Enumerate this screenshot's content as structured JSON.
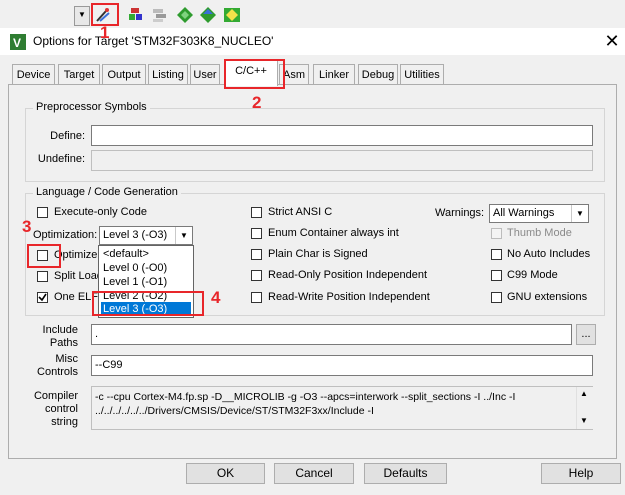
{
  "toolbar": {
    "icons": [
      "dropdown-arrow-icon",
      "magic-wand-options-icon",
      "stack-icon",
      "layers-icon",
      "diamond-green-icon",
      "diamond-move-icon",
      "diamond-multi-icon"
    ]
  },
  "dialog": {
    "title": "Options for Target 'STM32F303K8_NUCLEO'",
    "close": "✕"
  },
  "tabs": [
    "Device",
    "Target",
    "Output",
    "Listing",
    "User",
    "C/C++",
    "Asm",
    "Linker",
    "Debug",
    "Utilities"
  ],
  "active_tab": "C/C++",
  "preprocessor": {
    "group_title": "Preprocessor Symbols",
    "define_label": "Define:",
    "define_value": "",
    "undefine_label": "Undefine:",
    "undefine_value": ""
  },
  "language": {
    "group_title": "Language / Code Generation",
    "execute_only": "Execute-only Code",
    "optimization_label": "Optimization:",
    "optimization_value": "Level 3 (-O3)",
    "optimize_for_time": "Optimize f",
    "split_load": "Split Load",
    "one_elf": "One ELF",
    "strict_ansi": "Strict ANSI C",
    "enum_container": "Enum Container always int",
    "plain_char": "Plain Char is Signed",
    "ropi": "Read-Only Position Independent",
    "rwpi": "Read-Write Position Independent",
    "warnings_label": "Warnings:",
    "warnings_value": "All Warnings",
    "thumb_mode": "Thumb Mode",
    "no_auto_includes": "No Auto Includes",
    "c99_mode": "C99 Mode",
    "gnu_extensions": "GNU extensions",
    "dropdown_options": [
      "<default>",
      "Level 0 (-O0)",
      "Level 1 (-O1)",
      "Level 2 (-O2)",
      "Level 3 (-O3)"
    ]
  },
  "include": {
    "label_line1": "Include",
    "label_line2": "Paths",
    "value": ".",
    "browse": "..."
  },
  "misc": {
    "label_line1": "Misc",
    "label_line2": "Controls",
    "value": "--C99"
  },
  "compiler": {
    "label_line1": "Compiler",
    "label_line2": "control",
    "label_line3": "string",
    "line1": "-c --cpu Cortex-M4.fp.sp -D__MICROLIB -g -O3 --apcs=interwork --split_sections -I ../Inc -I",
    "line2": "../../../../../../Drivers/CMSIS/Device/ST/STM32F3xx/Include -I"
  },
  "buttons": {
    "ok": "OK",
    "cancel": "Cancel",
    "defaults": "Defaults",
    "help": "Help"
  },
  "annotations": [
    "1",
    "2",
    "3",
    "4"
  ],
  "colors": {
    "annotation_red": "#e8262a",
    "selection_blue": "#0078d7"
  }
}
